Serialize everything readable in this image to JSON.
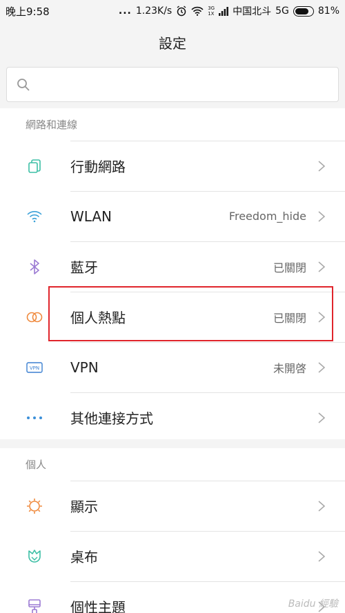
{
  "status_bar": {
    "time": "晚上9:58",
    "dots": "...",
    "speed": "1.23K/s",
    "network_top": "3G",
    "network_bottom": "1X",
    "carrier": "中国北斗",
    "network_type": "5G",
    "battery_percent": "81%",
    "battery_level": 0.81
  },
  "header": {
    "title": "設定"
  },
  "search": {
    "placeholder": ""
  },
  "sections": [
    {
      "label": "網路和連線",
      "items": [
        {
          "label": "行動網路",
          "value": "",
          "icon": "mobile-network-icon",
          "color": "#3cbfa5"
        },
        {
          "label": "WLAN",
          "value": "Freedom_hide",
          "icon": "wifi-icon",
          "color": "#3aa0d8"
        },
        {
          "label": "藍牙",
          "value": "已關閉",
          "icon": "bluetooth-icon",
          "color": "#9b7ad3"
        },
        {
          "label": "個人熱點",
          "value": "已關閉",
          "icon": "hotspot-icon",
          "color": "#ef8a3e"
        },
        {
          "label": "VPN",
          "value": "未開啓",
          "icon": "vpn-icon",
          "color": "#3a7fd1"
        },
        {
          "label": "其他連接方式",
          "value": "",
          "icon": "more-connections-icon",
          "color": "#3a8fd8"
        }
      ]
    },
    {
      "label": "個人",
      "items": [
        {
          "label": "顯示",
          "value": "",
          "icon": "display-icon",
          "color": "#ef8a3e"
        },
        {
          "label": "桌布",
          "value": "",
          "icon": "wallpaper-icon",
          "color": "#3cbfa5"
        },
        {
          "label": "個性主題",
          "value": "",
          "icon": "theme-icon",
          "color": "#9b7ad3"
        }
      ]
    }
  ],
  "watermark": "Baidu 經驗"
}
